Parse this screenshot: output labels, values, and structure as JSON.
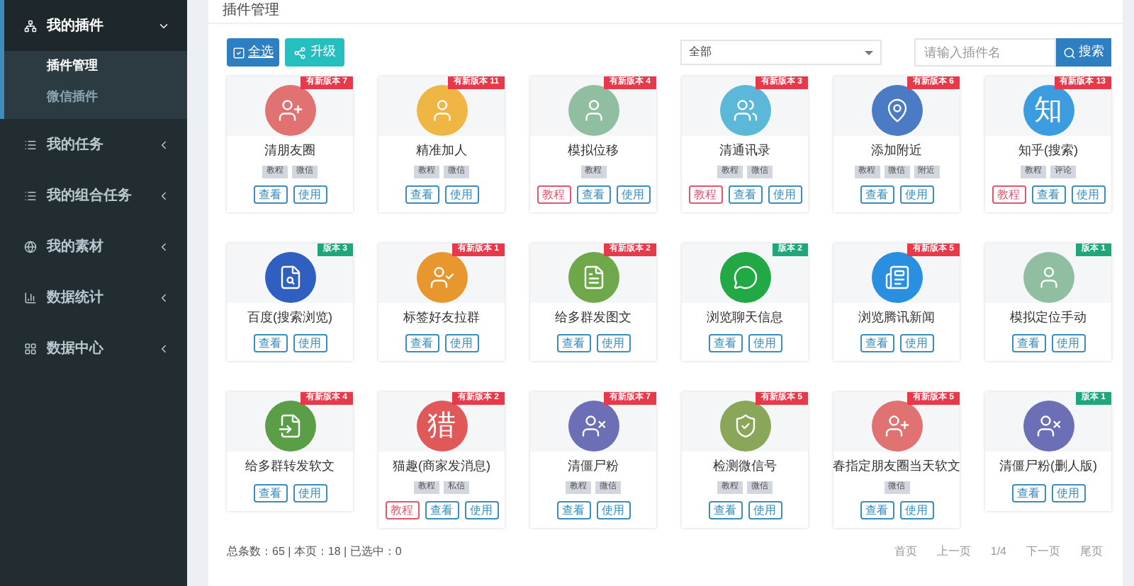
{
  "sidebar": {
    "items": [
      {
        "label": "我的插件",
        "expanded": true,
        "children": [
          {
            "label": "插件管理",
            "selected": true
          },
          {
            "label": "微信插件",
            "selected": false
          }
        ]
      },
      {
        "label": "我的任务",
        "expanded": false
      },
      {
        "label": "我的组合任务",
        "expanded": false
      },
      {
        "label": "我的素材",
        "expanded": false
      },
      {
        "label": "数据统计",
        "expanded": false
      },
      {
        "label": "数据中心",
        "expanded": false
      }
    ]
  },
  "panel": {
    "title": "插件管理"
  },
  "toolbar": {
    "select_all": "全选",
    "upgrade": "升级",
    "filter": "全部",
    "search": {
      "placeholder": "请输入插件名"
    },
    "search_button": "搜索"
  },
  "plugins": [
    {
      "name": "清朋友圈",
      "badge": {
        "kind": "new",
        "label": "有新版本 7"
      },
      "icon": {
        "kind": "user-plus",
        "color": "#e07272"
      },
      "tags": [
        "教程",
        "微信"
      ],
      "buttons": [
        {
          "kind": "view",
          "label": "查看"
        },
        {
          "kind": "use",
          "label": "使用"
        }
      ]
    },
    {
      "name": "精准加人",
      "badge": {
        "kind": "new",
        "label": "有新版本 11"
      },
      "icon": {
        "kind": "user",
        "color": "#efb643"
      },
      "tags": [
        "教程",
        "微信"
      ],
      "buttons": [
        {
          "kind": "view",
          "label": "查看"
        },
        {
          "kind": "use",
          "label": "使用"
        }
      ]
    },
    {
      "name": "模拟位移",
      "badge": {
        "kind": "new",
        "label": "有新版本 4"
      },
      "icon": {
        "kind": "user",
        "color": "#8fbfa0"
      },
      "tags": [
        "教程"
      ],
      "buttons": [
        {
          "kind": "tutorial",
          "label": "教程"
        },
        {
          "kind": "view",
          "label": "查看"
        },
        {
          "kind": "use",
          "label": "使用"
        }
      ]
    },
    {
      "name": "清通讯录",
      "badge": {
        "kind": "new",
        "label": "有新版本 3"
      },
      "icon": {
        "kind": "users",
        "color": "#5bb8d8"
      },
      "tags": [
        "教程",
        "微信"
      ],
      "buttons": [
        {
          "kind": "tutorial",
          "label": "教程"
        },
        {
          "kind": "view",
          "label": "查看"
        },
        {
          "kind": "use",
          "label": "使用"
        }
      ]
    },
    {
      "name": "添加附近",
      "badge": {
        "kind": "new",
        "label": "有新版本 6"
      },
      "icon": {
        "kind": "location",
        "color": "#4a7bc4"
      },
      "tags": [
        "教程",
        "微信",
        "附近"
      ],
      "buttons": [
        {
          "kind": "view",
          "label": "查看"
        },
        {
          "kind": "use",
          "label": "使用"
        }
      ]
    },
    {
      "name": "知乎(搜索)",
      "badge": {
        "kind": "new",
        "label": "有新版本 13"
      },
      "icon": {
        "kind": "glyph",
        "glyph": "知",
        "color": "#3b9de0"
      },
      "tags": [
        "教程",
        "评论"
      ],
      "buttons": [
        {
          "kind": "tutorial",
          "label": "教程"
        },
        {
          "kind": "view",
          "label": "查看"
        },
        {
          "kind": "use",
          "label": "使用"
        }
      ]
    },
    {
      "name": "百度(搜索浏览)",
      "badge": {
        "kind": "current",
        "label": "版本 3"
      },
      "icon": {
        "kind": "doc-search",
        "color": "#2f5fc0"
      },
      "buttons": [
        {
          "kind": "view",
          "label": "查看"
        },
        {
          "kind": "use",
          "label": "使用"
        }
      ]
    },
    {
      "name": "标签好友拉群",
      "badge": {
        "kind": "new",
        "label": "有新版本 1"
      },
      "icon": {
        "kind": "user-check",
        "color": "#e8962e"
      },
      "buttons": [
        {
          "kind": "view",
          "label": "查看"
        },
        {
          "kind": "use",
          "label": "使用"
        }
      ]
    },
    {
      "name": "给多群发图文",
      "badge": {
        "kind": "new",
        "label": "有新版本 2"
      },
      "icon": {
        "kind": "doc",
        "color": "#6ea84a"
      },
      "buttons": [
        {
          "kind": "view",
          "label": "查看"
        },
        {
          "kind": "use",
          "label": "使用"
        }
      ]
    },
    {
      "name": "浏览聊天信息",
      "badge": {
        "kind": "current",
        "label": "版本 2"
      },
      "icon": {
        "kind": "chat",
        "color": "#22a844"
      },
      "buttons": [
        {
          "kind": "view",
          "label": "查看"
        },
        {
          "kind": "use",
          "label": "使用"
        }
      ]
    },
    {
      "name": "浏览腾讯新闻",
      "badge": {
        "kind": "new",
        "label": "有新版本 5"
      },
      "icon": {
        "kind": "news",
        "color": "#2a8fe0"
      },
      "buttons": [
        {
          "kind": "view",
          "label": "查看"
        },
        {
          "kind": "use",
          "label": "使用"
        }
      ]
    },
    {
      "name": "模拟定位手动",
      "badge": {
        "kind": "current",
        "label": "版本 1"
      },
      "icon": {
        "kind": "user",
        "color": "#8fbfa0"
      },
      "buttons": [
        {
          "kind": "view",
          "label": "查看"
        },
        {
          "kind": "use",
          "label": "使用"
        }
      ]
    },
    {
      "name": "给多群转发软文",
      "badge": {
        "kind": "new",
        "label": "有新版本 4"
      },
      "icon": {
        "kind": "doc-forward",
        "color": "#5a9e48"
      },
      "buttons": [
        {
          "kind": "view",
          "label": "查看"
        },
        {
          "kind": "use",
          "label": "使用"
        }
      ]
    },
    {
      "name": "猫趣(商家发消息)",
      "badge": {
        "kind": "new",
        "label": "有新版本 2"
      },
      "icon": {
        "kind": "glyph",
        "glyph": "猎",
        "color": "#e05858"
      },
      "tags": [
        "教程",
        "私信"
      ],
      "buttons": [
        {
          "kind": "tutorial",
          "label": "教程"
        },
        {
          "kind": "view",
          "label": "查看"
        },
        {
          "kind": "use",
          "label": "使用"
        }
      ]
    },
    {
      "name": "清僵尸粉",
      "badge": {
        "kind": "new",
        "label": "有新版本 7"
      },
      "icon": {
        "kind": "user-x",
        "color": "#6c6fb5"
      },
      "tags": [
        "教程",
        "微信"
      ],
      "buttons": [
        {
          "kind": "view",
          "label": "查看"
        },
        {
          "kind": "use",
          "label": "使用"
        }
      ]
    },
    {
      "name": "检测微信号",
      "badge": {
        "kind": "new",
        "label": "有新版本 5"
      },
      "icon": {
        "kind": "shield",
        "color": "#8aa658"
      },
      "tags": [
        "教程",
        "微信"
      ],
      "buttons": [
        {
          "kind": "view",
          "label": "查看"
        },
        {
          "kind": "use",
          "label": "使用"
        }
      ]
    },
    {
      "name": "春指定朋友圈当天软文",
      "badge": {
        "kind": "new",
        "label": "有新版本 5"
      },
      "icon": {
        "kind": "user-plus",
        "color": "#e07272"
      },
      "tags": [
        "微信"
      ],
      "buttons": [
        {
          "kind": "view",
          "label": "查看"
        },
        {
          "kind": "use",
          "label": "使用"
        }
      ]
    },
    {
      "name": "清僵尸粉(删人版)",
      "badge": {
        "kind": "current",
        "label": "版本 1"
      },
      "icon": {
        "kind": "user-x",
        "color": "#6c6fb5"
      },
      "buttons": [
        {
          "kind": "view",
          "label": "查看"
        },
        {
          "kind": "use",
          "label": "使用"
        }
      ]
    }
  ],
  "summary": "总条数：65 | 本页：18 | 已选中：0",
  "pagination": [
    "首页",
    "上一页",
    "1/4",
    "下一页",
    "尾页"
  ]
}
